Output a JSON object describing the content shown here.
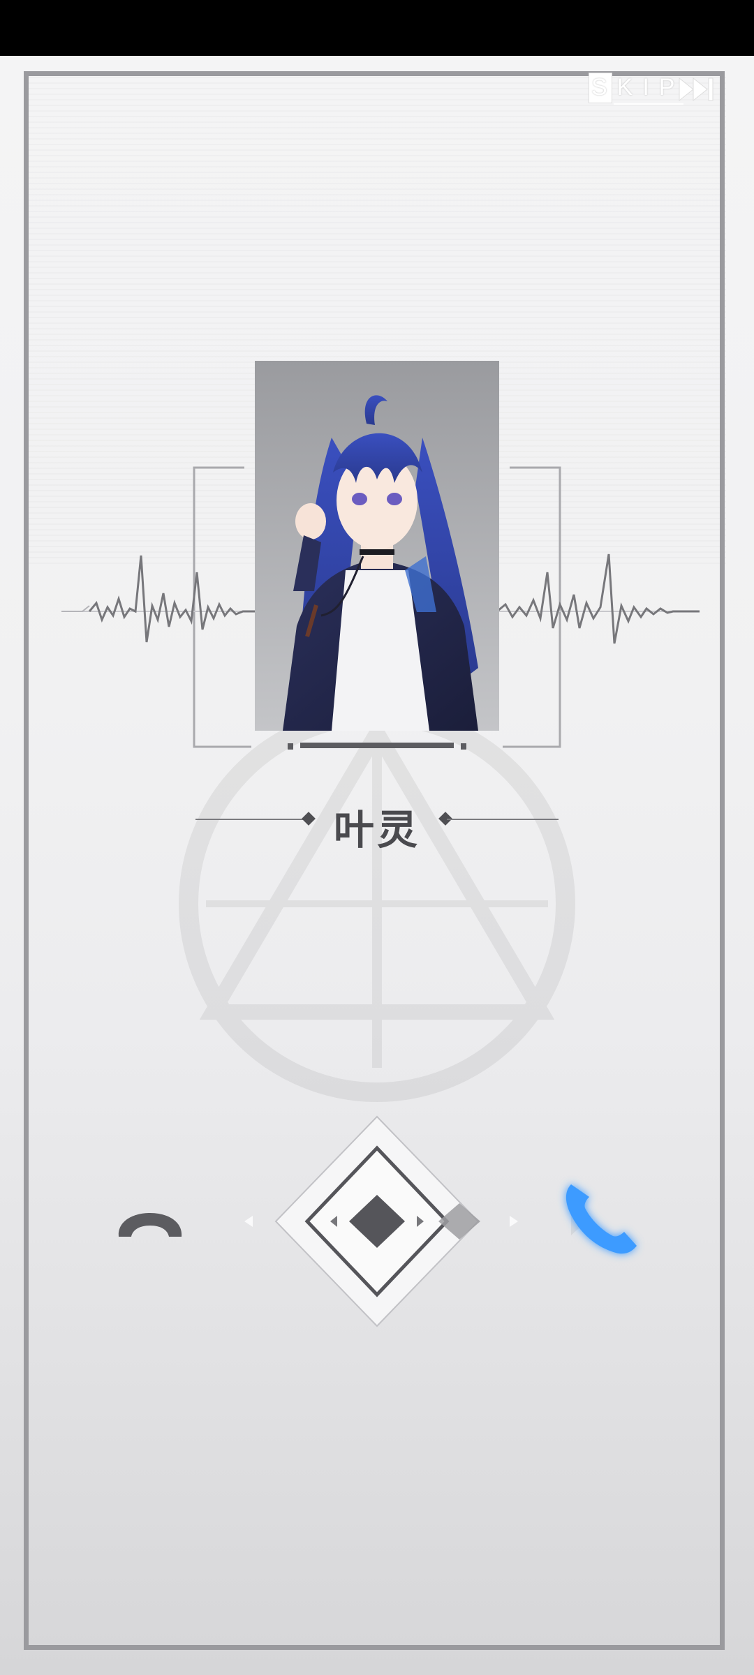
{
  "skip": {
    "label": "SKIP"
  },
  "caller": {
    "name": "叶灵"
  },
  "controls": {
    "decline_icon": "phone-hangup-icon",
    "accept_icon": "phone-icon",
    "slider_icon": "diamond-slider-icon"
  },
  "colors": {
    "accent": "#3d9bff",
    "decline": "#5c5c60",
    "frame": "#9a9a9e",
    "text": "#4a4a4e"
  }
}
